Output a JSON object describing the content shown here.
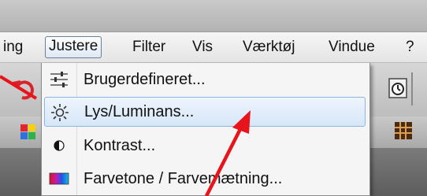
{
  "menubar": {
    "items": [
      {
        "label": "ing",
        "active": false
      },
      {
        "label": "Justere",
        "active": true
      },
      {
        "label": "Filter",
        "active": false
      },
      {
        "label": "Vis",
        "active": false
      },
      {
        "label": "Værktøj",
        "active": false
      },
      {
        "label": "Vindue",
        "active": false
      },
      {
        "label": "?",
        "active": false
      }
    ]
  },
  "dropdown": {
    "items": [
      {
        "label": "Brugerdefineret...",
        "icon": "sliders-icon",
        "highlighted": false
      },
      {
        "label": "Lys/Luminans...",
        "icon": "sun-icon",
        "highlighted": true
      },
      {
        "label": "Kontrast...",
        "icon": "contrast-icon",
        "highlighted": false
      },
      {
        "label": "Farvetone / Farvemætning...",
        "icon": "color-gradient-icon",
        "highlighted": false
      }
    ]
  },
  "annotation": {
    "arrow_color": "#e8141b"
  }
}
